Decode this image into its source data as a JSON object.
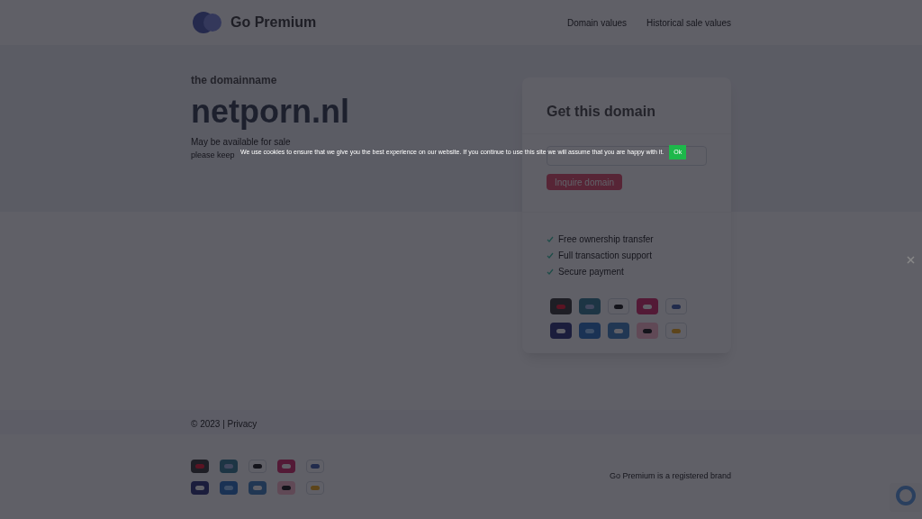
{
  "header": {
    "brand": "Go Premium",
    "nav": [
      {
        "label": "Domain values"
      },
      {
        "label": "Historical sale values"
      }
    ]
  },
  "hero": {
    "kicker": "the domainname",
    "domain": "netporn.nl",
    "status": "May be available for sale",
    "note": "please keep"
  },
  "card": {
    "title": "Get this domain",
    "button": "Inquire domain",
    "features": [
      "Free ownership transfer",
      "Full transaction support",
      "Secure payment"
    ]
  },
  "payment_methods": [
    {
      "kind": "mastercard"
    },
    {
      "kind": "card"
    },
    {
      "kind": "applepay"
    },
    {
      "kind": "giropay"
    },
    {
      "kind": "sepa"
    },
    {
      "kind": "visa"
    },
    {
      "kind": "paypal"
    },
    {
      "kind": "amex"
    },
    {
      "kind": "klarna"
    },
    {
      "kind": "bancontact"
    }
  ],
  "footer": {
    "copyright": "© 2023 | Privacy",
    "brand_note": "Go Premium is a registered brand"
  },
  "cookie_banner": {
    "text": "We use cookies to ensure that we give you the best experience on our website. If you continue to use this site we will assume that you are happy with it.",
    "button": "Ok"
  }
}
